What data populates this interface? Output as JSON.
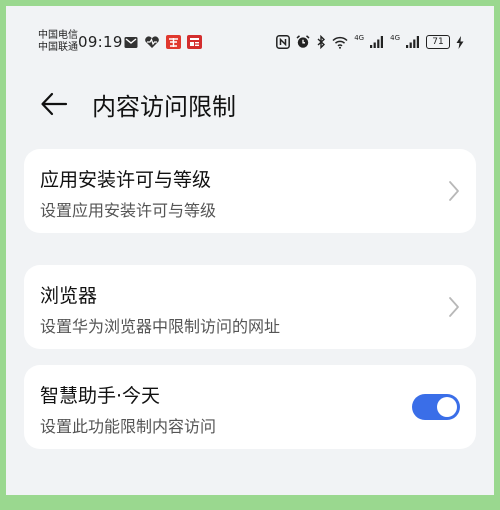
{
  "status_bar": {
    "carrier1": "中国电信",
    "carrier2": "中国联通",
    "time": "09:19",
    "network1": "4G",
    "network2": "4G",
    "battery": "71",
    "notification_icons": [
      "mail-icon",
      "health-icon",
      "taobao-icon",
      "news-icon"
    ],
    "system_icons": [
      "nfc-icon",
      "alarm-icon",
      "bluetooth-icon",
      "wifi-icon",
      "signal-icon",
      "signal-icon",
      "battery-icon",
      "charging-icon"
    ]
  },
  "header": {
    "title": "内容访问限制",
    "back_icon": "arrow-left-icon"
  },
  "settings": [
    {
      "title": "应用安装许可与等级",
      "subtitle": "设置应用安装许可与等级",
      "control": "chevron"
    },
    {
      "title": "浏览器",
      "subtitle": "设置华为浏览器中限制访问的网址",
      "control": "chevron"
    },
    {
      "title": "智慧助手·今天",
      "subtitle": "设置此功能限制内容访问",
      "control": "toggle",
      "toggle_on": true
    }
  ],
  "colors": {
    "accent": "#3a6ee8",
    "background": "#f1f3f5",
    "card": "#ffffff",
    "frame": "#9ad88f"
  }
}
